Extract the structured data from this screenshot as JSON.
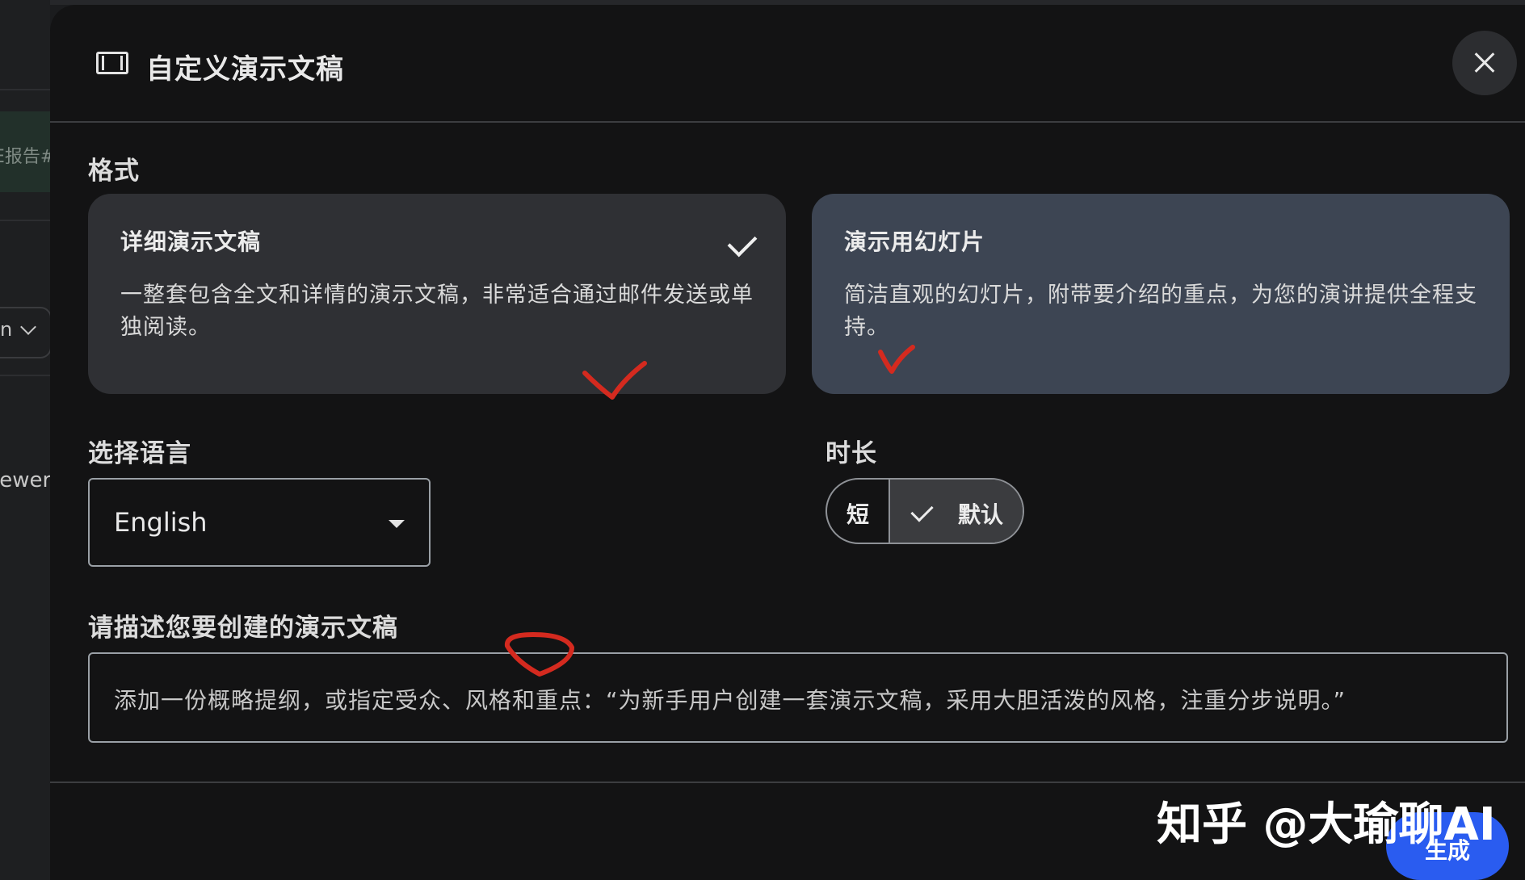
{
  "background_app": {
    "chip_text": "E报告#",
    "select_text": "n",
    "viewer_text": "iewer"
  },
  "dialog": {
    "title": "自定义演示文稿",
    "format": {
      "label": "格式",
      "options": [
        {
          "title": "详细演示文稿",
          "description": "一整套包含全文和详情的演示文稿，非常适合通过邮件发送或单独阅读。",
          "selected": true
        },
        {
          "title": "演示用幻灯片",
          "description": "简洁直观的幻灯片，附带要介绍的重点，为您的演讲提供全程支持。",
          "selected": false
        }
      ]
    },
    "language": {
      "label": "选择语言",
      "value": "English"
    },
    "duration": {
      "label": "时长",
      "options": [
        "短",
        "默认"
      ],
      "selected": "默认"
    },
    "description": {
      "label": "请描述您要创建的演示文稿",
      "placeholder": "添加一份概略提纲，或指定受众、风格和重点：“为新手用户创建一套演示文稿，采用大胆活泼的风格，注重分步说明。”"
    },
    "generate_label": "生成"
  },
  "watermark": "知乎 @大瑜聊AI",
  "colors": {
    "dialog_bg": "#131314",
    "selected_card": "#2f3034",
    "alt_card": "#3d4553",
    "primary_button": "#2a5cf0",
    "annotation_red": "#d42a1f"
  },
  "icons": [
    "slides-icon",
    "close-icon",
    "check-icon",
    "dropdown-caret-icon",
    "chevron-down-icon"
  ]
}
